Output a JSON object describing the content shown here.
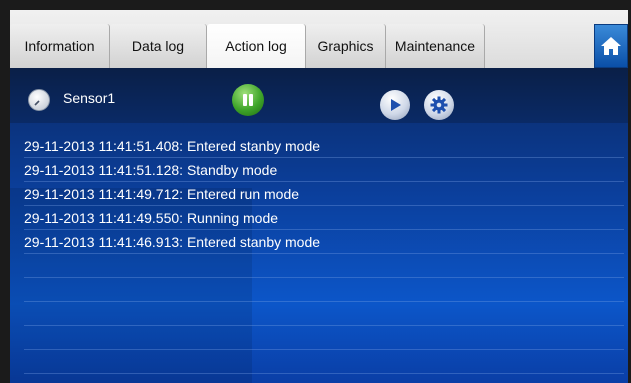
{
  "tabs": [
    {
      "label": "Information",
      "active": false
    },
    {
      "label": "Data log",
      "active": false
    },
    {
      "label": "Action log",
      "active": true
    },
    {
      "label": "Graphics",
      "active": false
    },
    {
      "label": "Maintenance",
      "active": false
    }
  ],
  "home_icon": "home-icon",
  "toolbar": {
    "sensor_label": "Sensor1",
    "sensor_icon": "gauge-icon",
    "pause_icon": "pause-icon",
    "play_icon": "play-icon",
    "settings_icon": "gear-icon"
  },
  "colors": {
    "panel_blue": "#0c56c9",
    "pause_green": "#3fa52a",
    "tab_bar": "#e6e6e6"
  },
  "log_entries": [
    "29-11-2013 11:41:51.408: Entered stanby mode",
    "29-11-2013 11:41:51.128: Standby mode",
    "29-11-2013 11:41:49.712: Entered run mode",
    "29-11-2013 11:41:49.550: Running mode",
    "29-11-2013 11:41:46.913: Entered stanby mode",
    "",
    "",
    "",
    "",
    "",
    ""
  ]
}
